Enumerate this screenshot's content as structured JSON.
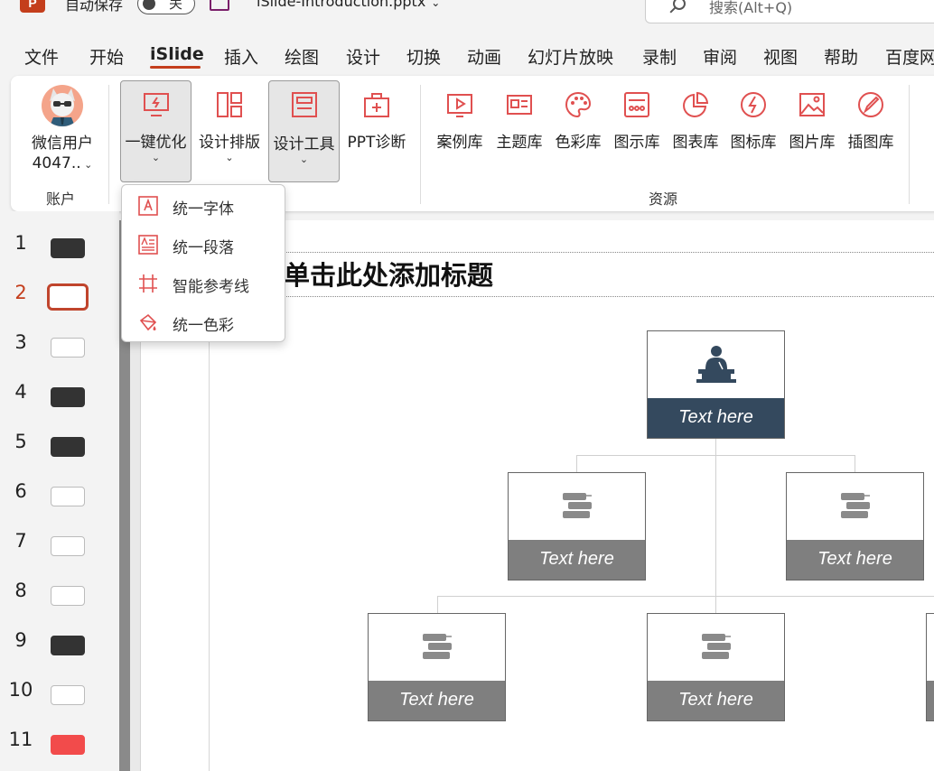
{
  "titlebar": {
    "app_logo": "P",
    "autosave_label": "自动保存",
    "autosave_state": "关",
    "file_name": "iSlide-Introduction.pptx",
    "search_placeholder": "搜索(Alt+Q)"
  },
  "menu_tabs": [
    "文件",
    "开始",
    "iSlide",
    "插入",
    "绘图",
    "设计",
    "切换",
    "动画",
    "幻灯片放映",
    "录制",
    "审阅",
    "视图",
    "帮助",
    "百度网"
  ],
  "active_tab": "iSlide",
  "ribbon": {
    "account": {
      "user_line1": "微信用户",
      "user_line2": "4047..",
      "group_label": "账户"
    },
    "tools": [
      {
        "label": "一键优化",
        "icon": "optimize-icon"
      },
      {
        "label": "设计排版",
        "icon": "layout-icon"
      },
      {
        "label": "设计工具",
        "icon": "design-tools-icon"
      },
      {
        "label": "PPT诊断",
        "icon": "diagnosis-icon"
      }
    ],
    "resources": [
      {
        "label": "案例库",
        "icon": "case-library-icon"
      },
      {
        "label": "主题库",
        "icon": "theme-library-icon"
      },
      {
        "label": "色彩库",
        "icon": "color-palette-icon"
      },
      {
        "label": "图示库",
        "icon": "diagram-library-icon"
      },
      {
        "label": "图表库",
        "icon": "chart-library-icon"
      },
      {
        "label": "图标库",
        "icon": "icon-library-icon"
      },
      {
        "label": "图片库",
        "icon": "picture-library-icon"
      },
      {
        "label": "插图库",
        "icon": "illustration-library-icon"
      }
    ],
    "resources_group_label": "资源"
  },
  "dropdown": {
    "items": [
      {
        "label": "统一字体",
        "icon": "unify-font-icon"
      },
      {
        "label": "统一段落",
        "icon": "unify-paragraph-icon"
      },
      {
        "label": "智能参考线",
        "icon": "smart-guides-icon"
      },
      {
        "label": "统一色彩",
        "icon": "unify-color-icon"
      }
    ]
  },
  "slides": {
    "numbers": [
      "1",
      "2",
      "3",
      "4",
      "5",
      "6",
      "7",
      "8",
      "9",
      "10",
      "11"
    ],
    "active": "2"
  },
  "slide_content": {
    "title": "单击此处添加标题",
    "nodes": [
      "Text here",
      "Text here",
      "Text here",
      "Text here",
      "Text here"
    ]
  },
  "colors": {
    "accent": "#c43e1c",
    "top_node": "#34495e",
    "child_node": "#7f7f7f",
    "icon_red": "#e05050"
  }
}
